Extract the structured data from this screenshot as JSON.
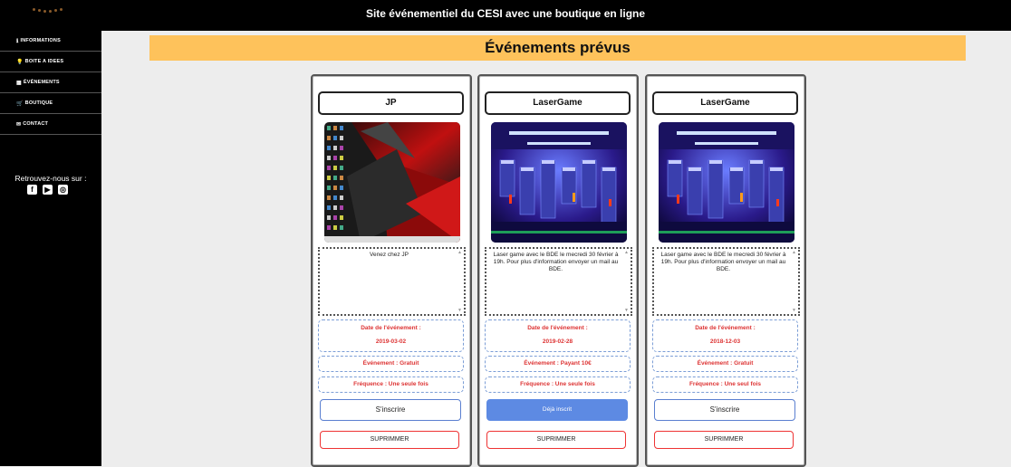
{
  "site": {
    "title": "Site événementiel du CESI avec une boutique en ligne"
  },
  "sidebar": {
    "items": [
      {
        "icon": "info-icon",
        "glyph": "ℹ",
        "label": "INFORMATIONS"
      },
      {
        "icon": "lightbulb-icon",
        "glyph": "💡",
        "label": "BOITE A IDEES"
      },
      {
        "icon": "calendar-icon",
        "glyph": "▦",
        "label": "ÉVÉNEMENTS"
      },
      {
        "icon": "cart-icon",
        "glyph": "🛒",
        "label": "BOUTIQUE"
      },
      {
        "icon": "envelope-icon",
        "glyph": "✉",
        "label": "CONTACT"
      }
    ],
    "follow_text": "Retrouvez-nous sur :",
    "socials": [
      {
        "icon": "facebook-icon",
        "glyph": "f"
      },
      {
        "icon": "youtube-icon",
        "glyph": "▶"
      },
      {
        "icon": "instagram-icon",
        "glyph": "◎"
      }
    ]
  },
  "page": {
    "heading": "Événements prévus"
  },
  "events": [
    {
      "title": "JP",
      "image": "desktop-screenshot",
      "description": "Venez chez JP",
      "date_label": "Date de l'événement :",
      "date": "2019-03-02",
      "type": "Événement : Gratuit",
      "frequency": "Fréquence : Une seule fois",
      "register_label": "S'inscrire",
      "registered": false,
      "delete_label": "SUPRIMMER"
    },
    {
      "title": "LaserGame",
      "image": "lasergame-arena",
      "description": "Laser game avec le BDE le mecredi 30 février à 19h. Pour plus d'information envoyer un mail au BDE.",
      "date_label": "Date de l'événement :",
      "date": "2019-02-28",
      "type": "Événement : Payant 10€",
      "frequency": "Fréquence : Une seule fois",
      "register_label": "Déjà inscrit",
      "registered": true,
      "delete_label": "SUPRIMMER"
    },
    {
      "title": "LaserGame",
      "image": "lasergame-arena",
      "description": "Laser game avec le BDE le mecredi 30 février à 19h. Pour plus d'information envoyer un mail au BDE.",
      "date_label": "Date de l'événement :",
      "date": "2018-12-03",
      "type": "Événement : Gratuit",
      "frequency": "Fréquence : Une seul fois",
      "register_label": "S'inscrire",
      "registered": false,
      "delete_label": "SUPRIMMER"
    }
  ]
}
